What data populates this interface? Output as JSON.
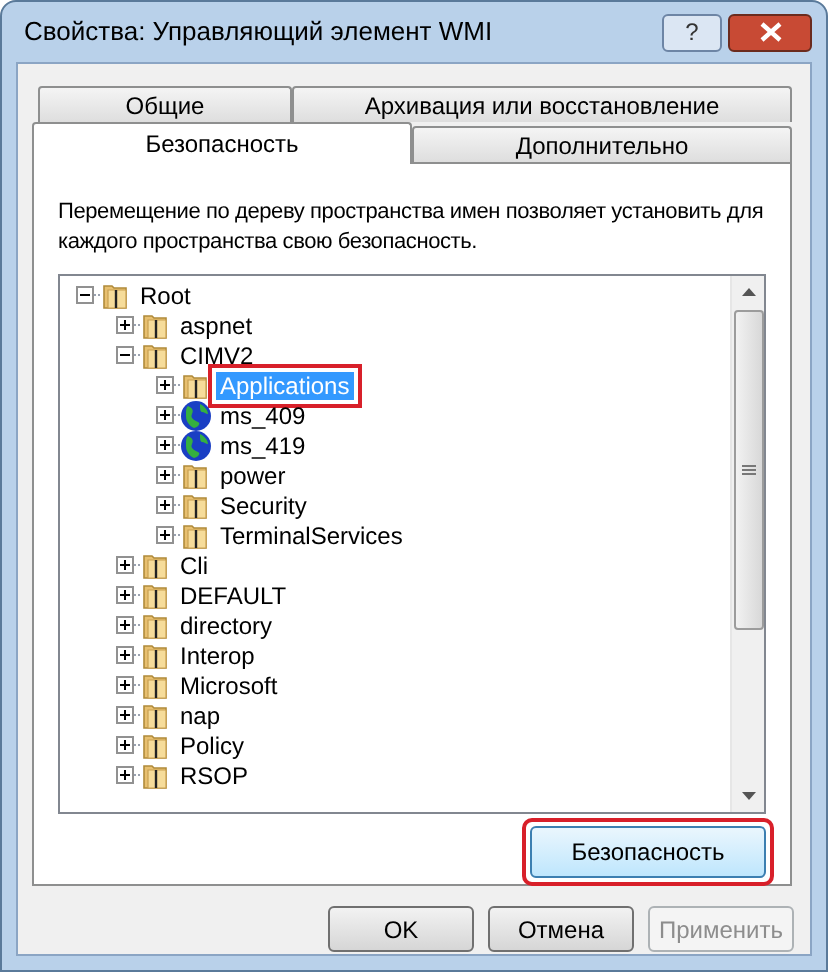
{
  "window": {
    "title": "Свойства: Управляющий элемент WMI",
    "help": "?"
  },
  "tabs": [
    [
      {
        "label": "Общие",
        "selected": false
      },
      {
        "label": "Архивация или восстановление",
        "selected": false
      }
    ],
    [
      {
        "label": "Безопасность",
        "selected": true
      },
      {
        "label": "Дополнительно",
        "selected": false
      }
    ]
  ],
  "description": "Перемещение по дереву пространства имен позволяет установить для каждого пространства свою безопасность.",
  "tree": [
    {
      "label": "Root",
      "kind": "folder",
      "expanded": true,
      "selected": false,
      "highlighted": false,
      "children": [
        {
          "label": "aspnet",
          "kind": "folder",
          "expanded": false,
          "selected": false,
          "highlighted": false
        },
        {
          "label": "CIMV2",
          "kind": "folder",
          "expanded": true,
          "selected": false,
          "highlighted": false,
          "children": [
            {
              "label": "Applications",
              "kind": "folder",
              "expanded": false,
              "selected": true,
              "highlighted": true
            },
            {
              "label": "ms_409",
              "kind": "globe",
              "expanded": false,
              "selected": false,
              "highlighted": false
            },
            {
              "label": "ms_419",
              "kind": "globe",
              "expanded": false,
              "selected": false,
              "highlighted": false
            },
            {
              "label": "power",
              "kind": "folder",
              "expanded": false,
              "selected": false,
              "highlighted": false
            },
            {
              "label": "Security",
              "kind": "folder",
              "expanded": false,
              "selected": false,
              "highlighted": false
            },
            {
              "label": "TerminalServices",
              "kind": "folder",
              "expanded": false,
              "selected": false,
              "highlighted": false
            }
          ]
        },
        {
          "label": "Cli",
          "kind": "folder",
          "expanded": false,
          "selected": false,
          "highlighted": false
        },
        {
          "label": "DEFAULT",
          "kind": "folder",
          "expanded": false,
          "selected": false,
          "highlighted": false
        },
        {
          "label": "directory",
          "kind": "folder",
          "expanded": false,
          "selected": false,
          "highlighted": false
        },
        {
          "label": "Interop",
          "kind": "folder",
          "expanded": false,
          "selected": false,
          "highlighted": false
        },
        {
          "label": "Microsoft",
          "kind": "folder",
          "expanded": false,
          "selected": false,
          "highlighted": false
        },
        {
          "label": "nap",
          "kind": "folder",
          "expanded": false,
          "selected": false,
          "highlighted": false
        },
        {
          "label": "Policy",
          "kind": "folder",
          "expanded": false,
          "selected": false,
          "highlighted": false
        },
        {
          "label": "RSOP",
          "kind": "folder",
          "expanded": false,
          "selected": false,
          "highlighted": false
        }
      ]
    }
  ],
  "security_button": {
    "label": "Безопасность",
    "highlighted": true
  },
  "buttons": [
    {
      "label": "OK",
      "disabled": false
    },
    {
      "label": "Отмена",
      "disabled": false
    },
    {
      "label": "Применить",
      "disabled": true
    }
  ]
}
